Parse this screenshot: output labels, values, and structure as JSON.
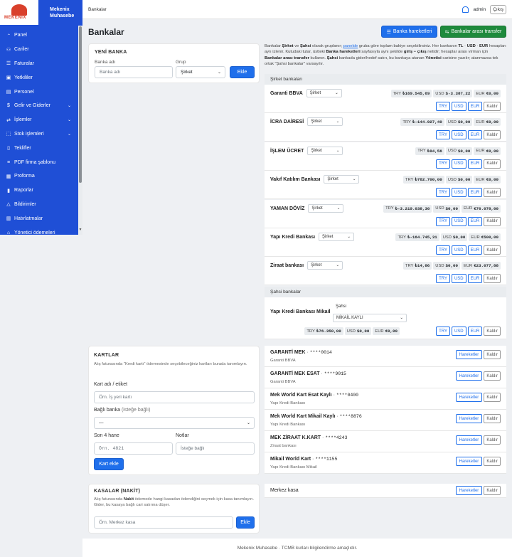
{
  "brand": {
    "logo_text": "MEKENIX",
    "name_line1": "Mekenix",
    "name_line2": "Muhasebe"
  },
  "sidebar": {
    "items": [
      {
        "label": "Panel",
        "icon": "gauge-icon",
        "chevron": false
      },
      {
        "label": "Cariler",
        "icon": "users-icon",
        "chevron": false
      },
      {
        "label": "Faturalar",
        "icon": "list-icon",
        "chevron": false
      },
      {
        "label": "Yetkililer",
        "icon": "id-card-icon",
        "chevron": false
      },
      {
        "label": "Personel",
        "icon": "badge-icon",
        "chevron": false
      },
      {
        "label": "Gelir ve Giderler",
        "icon": "money-icon",
        "chevron": true
      },
      {
        "label": "İşlemler",
        "icon": "exchange-icon",
        "chevron": true
      },
      {
        "label": "Stok işlemleri",
        "icon": "box-icon",
        "chevron": true
      },
      {
        "label": "Teklifler",
        "icon": "doc-icon",
        "chevron": false
      },
      {
        "label": "PDF firma şablonu",
        "icon": "sliders-icon",
        "chevron": false
      },
      {
        "label": "Proforma",
        "icon": "receipt-icon",
        "chevron": false
      },
      {
        "label": "Raporlar",
        "icon": "chart-icon",
        "chevron": false
      },
      {
        "label": "Bildirimler",
        "icon": "bell-icon",
        "chevron": false
      },
      {
        "label": "Hatırlatmalar",
        "icon": "calendar-icon",
        "chevron": false
      },
      {
        "label": "Yönetici ödemeleri",
        "icon": "bank-icon",
        "chevron": false
      }
    ]
  },
  "topbar": {
    "breadcrumb": "Bankalar",
    "user": "admin",
    "logout": "Çıkış"
  },
  "header": {
    "title": "Bankalar",
    "btn_movements": "Banka hareketleri",
    "btn_transfer": "Bankalar arası transfer"
  },
  "new_bank": {
    "title": "YENİ BANKA",
    "name_label": "Banka adı",
    "name_placeholder": "Banka adı",
    "group_label": "Grup",
    "group_value": "Şirket",
    "add": "Ekle"
  },
  "desc": {
    "p1": "Bankalar ",
    "b1": "Şirket",
    "p2": " ve ",
    "b2": "Şahsi",
    "p3": " olarak gruplanır; ",
    "link": "panelde",
    "p4": " gruba göre toplam bakiye seçebilirsiniz. Her bankanın ",
    "b3": "TL",
    "p5": " · ",
    "b4": "USD",
    "p6": " · ",
    "b5": "EUR",
    "p7": " hesapları ayrı izlenir. Kutudaki tutar, üstteki ",
    "b6": "Banka hareketleri",
    "p8": " sayfasıyla aynı şekilde ",
    "b7": "giriş − çıkış",
    "p9": " netidir; hesaplar arası virman için ",
    "b8": "Bankalar arası transfer",
    "p10": " kullanın. ",
    "b9": "Şahsi",
    "p11": " bankada gider/hedef satırı, bu bankaya atanan ",
    "b10": "Yönetici",
    "p12": " carisine yazılır; atanmazsa tek ortak \"Şahsi bankalar\" varsayılır."
  },
  "company_banks": {
    "section": "Şirket bankaları",
    "rows": [
      {
        "name": "Garanti BBVA",
        "group": "Şirket",
        "try": "₺169.545,69",
        "usd": "$-3.387,22",
        "eur": "€0,00"
      },
      {
        "name": "İCRA DAİRESİ",
        "group": "Şirket",
        "try": "₺-144.927,40",
        "usd": "$0,00",
        "eur": "€0,00"
      },
      {
        "name": "İŞLEM ÜCRET",
        "group": "Şirket",
        "try": "₺94,56",
        "usd": "$0,00",
        "eur": "€0,00"
      },
      {
        "name": "Vakıf Katılım Bankası",
        "group": "Şirket",
        "try": "₺782.700,00",
        "usd": "$0,00",
        "eur": "€0,00"
      },
      {
        "name": "YAMAN DÖVİZ",
        "group": "Şirket",
        "try": "₺-3.219.038,30",
        "usd": "$0,00",
        "eur": "€76.078,00"
      },
      {
        "name": "Yapı Kredi Bankası",
        "group": "Şirket",
        "try": "₺-164.745,31",
        "usd": "$0,00",
        "eur": "€500,00"
      },
      {
        "name": "Ziraat bankası",
        "group": "Şirket",
        "try": "₺14,86",
        "usd": "$0,00",
        "eur": "€23.077,88"
      }
    ]
  },
  "personal_banks": {
    "section": "Şahsi bankalar",
    "rows": [
      {
        "name": "Yapı Kredi Bankası Mikail",
        "group": "Şahsi",
        "owner": "MİKAİL KAYLI",
        "try": "₺76.350,00",
        "usd": "$0,00",
        "eur": "€0,00"
      }
    ]
  },
  "labels": {
    "try": "TRY",
    "usd": "USD",
    "eur": "EUR",
    "remove": "Kaldır",
    "movements": "Hareketler"
  },
  "cards_form": {
    "title": "KARTLAR",
    "hint": "Alış faturasında \"Kredi kartı\" ödemesinde seçebileceğiniz kartları burada tanımlayın.",
    "name_label": "Kart adı / etiket",
    "name_placeholder": "Örn. İş yeri kartı",
    "bank_label": "Bağlı banka",
    "bank_optional": "(isteğe bağlı)",
    "bank_value": "—",
    "last4_label": "Son 4 hane",
    "last4_placeholder": "Örn. 4821",
    "notes_label": "Notlar",
    "notes_placeholder": "İsteğe bağlı",
    "add": "Kart ekle"
  },
  "cards": [
    {
      "name": "GARANTİ MEK",
      "mask": "****0014",
      "bank": "Garanti BBVA"
    },
    {
      "name": "GARANTİ MEK ESAT",
      "mask": "****9015",
      "bank": "Garanti BBVA"
    },
    {
      "name": "Mek World Kart Esat Kaylı",
      "mask": "****0400",
      "bank": "Yapı Kredi Bankası"
    },
    {
      "name": "Mek World Kart Mikail Kaylı",
      "mask": "****8876",
      "bank": "Yapı Kredi Bankası"
    },
    {
      "name": "MEK ZİRAAT K.KART",
      "mask": "****4243",
      "bank": "Ziraat bankası"
    },
    {
      "name": "Mikail World Kart",
      "mask": "****1155",
      "bank": "Yapı Kredi Bankası Mikail"
    }
  ],
  "cash_form": {
    "title": "KASALAR (NAKİT)",
    "hint_p1": "Alış faturasında ",
    "hint_b": "Nakit",
    "hint_p2": " ödemede hangi kasadan ödendiğini seçmek için kasa tanımlayın. Gider, bu kasaya bağlı cari satırına düşer.",
    "placeholder": "Örn. Merkez kasa",
    "add": "Ekle"
  },
  "cash": [
    {
      "name": "Merkez kasa"
    }
  ],
  "footer": {
    "text": "Mekenix Muhasebe · TCMB kurları bilgilendirme amaçlıdır."
  },
  "colors": {
    "primary": "#1f6feb",
    "sidebar": "#1f4fd6",
    "success": "#1e8a3c",
    "brand_red": "#d9402b"
  }
}
